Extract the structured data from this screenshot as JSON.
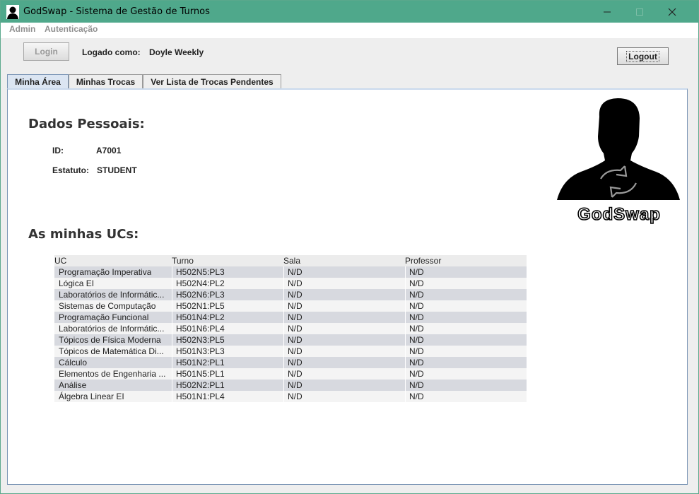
{
  "window": {
    "title": "GodSwap - Sistema de Gestão de Turnos"
  },
  "menu": [
    "Admin",
    "Autenticação"
  ],
  "toolbar": {
    "login_label": "Login",
    "logged_as_label": "Logado como:",
    "user_name": "Doyle Weekly",
    "logout_label": "Logout"
  },
  "tabs": [
    "Minha Área",
    "Minhas Trocas",
    "Ver Lista de Trocas Pendentes"
  ],
  "personal": {
    "heading": "Dados Pessoais:",
    "id_label": "ID:",
    "id_value": "A7001",
    "status_label": "Estatuto:",
    "status_value": "STUDENT"
  },
  "ucs": {
    "heading": "As minhas UCs:",
    "columns": [
      "UC",
      "Turno",
      "Sala",
      "Professor"
    ],
    "rows": [
      [
        "Programação Imperativa",
        "H502N5:PL3",
        "N/D",
        "N/D"
      ],
      [
        "Lógica EI",
        "H502N4:PL2",
        "N/D",
        "N/D"
      ],
      [
        "Laboratórios de Informátic...",
        "H502N6:PL3",
        "N/D",
        "N/D"
      ],
      [
        "Sistemas de Computação",
        "H502N1:PL5",
        "N/D",
        "N/D"
      ],
      [
        "Programação Funcional",
        "H501N4:PL2",
        "N/D",
        "N/D"
      ],
      [
        "Laboratórios de Informátic...",
        "H501N6:PL4",
        "N/D",
        "N/D"
      ],
      [
        "Tópicos de Física Moderna",
        "H502N3:PL5",
        "N/D",
        "N/D"
      ],
      [
        "Tópicos de Matemática Di...",
        "H501N3:PL3",
        "N/D",
        "N/D"
      ],
      [
        "Cálculo",
        "H501N2:PL1",
        "N/D",
        "N/D"
      ],
      [
        "Elementos de Engenharia ...",
        "H501N5:PL1",
        "N/D",
        "N/D"
      ],
      [
        "Análise",
        "H502N2:PL1",
        "N/D",
        "N/D"
      ],
      [
        "Álgebra Linear EI",
        "H501N1:PL4",
        "N/D",
        "N/D"
      ]
    ]
  },
  "logo": {
    "text": "GodSwap"
  },
  "colors": {
    "titlebar": "#4fa88b",
    "row_alt": "#d7d9df",
    "tab_active": "#dbe5f2"
  }
}
